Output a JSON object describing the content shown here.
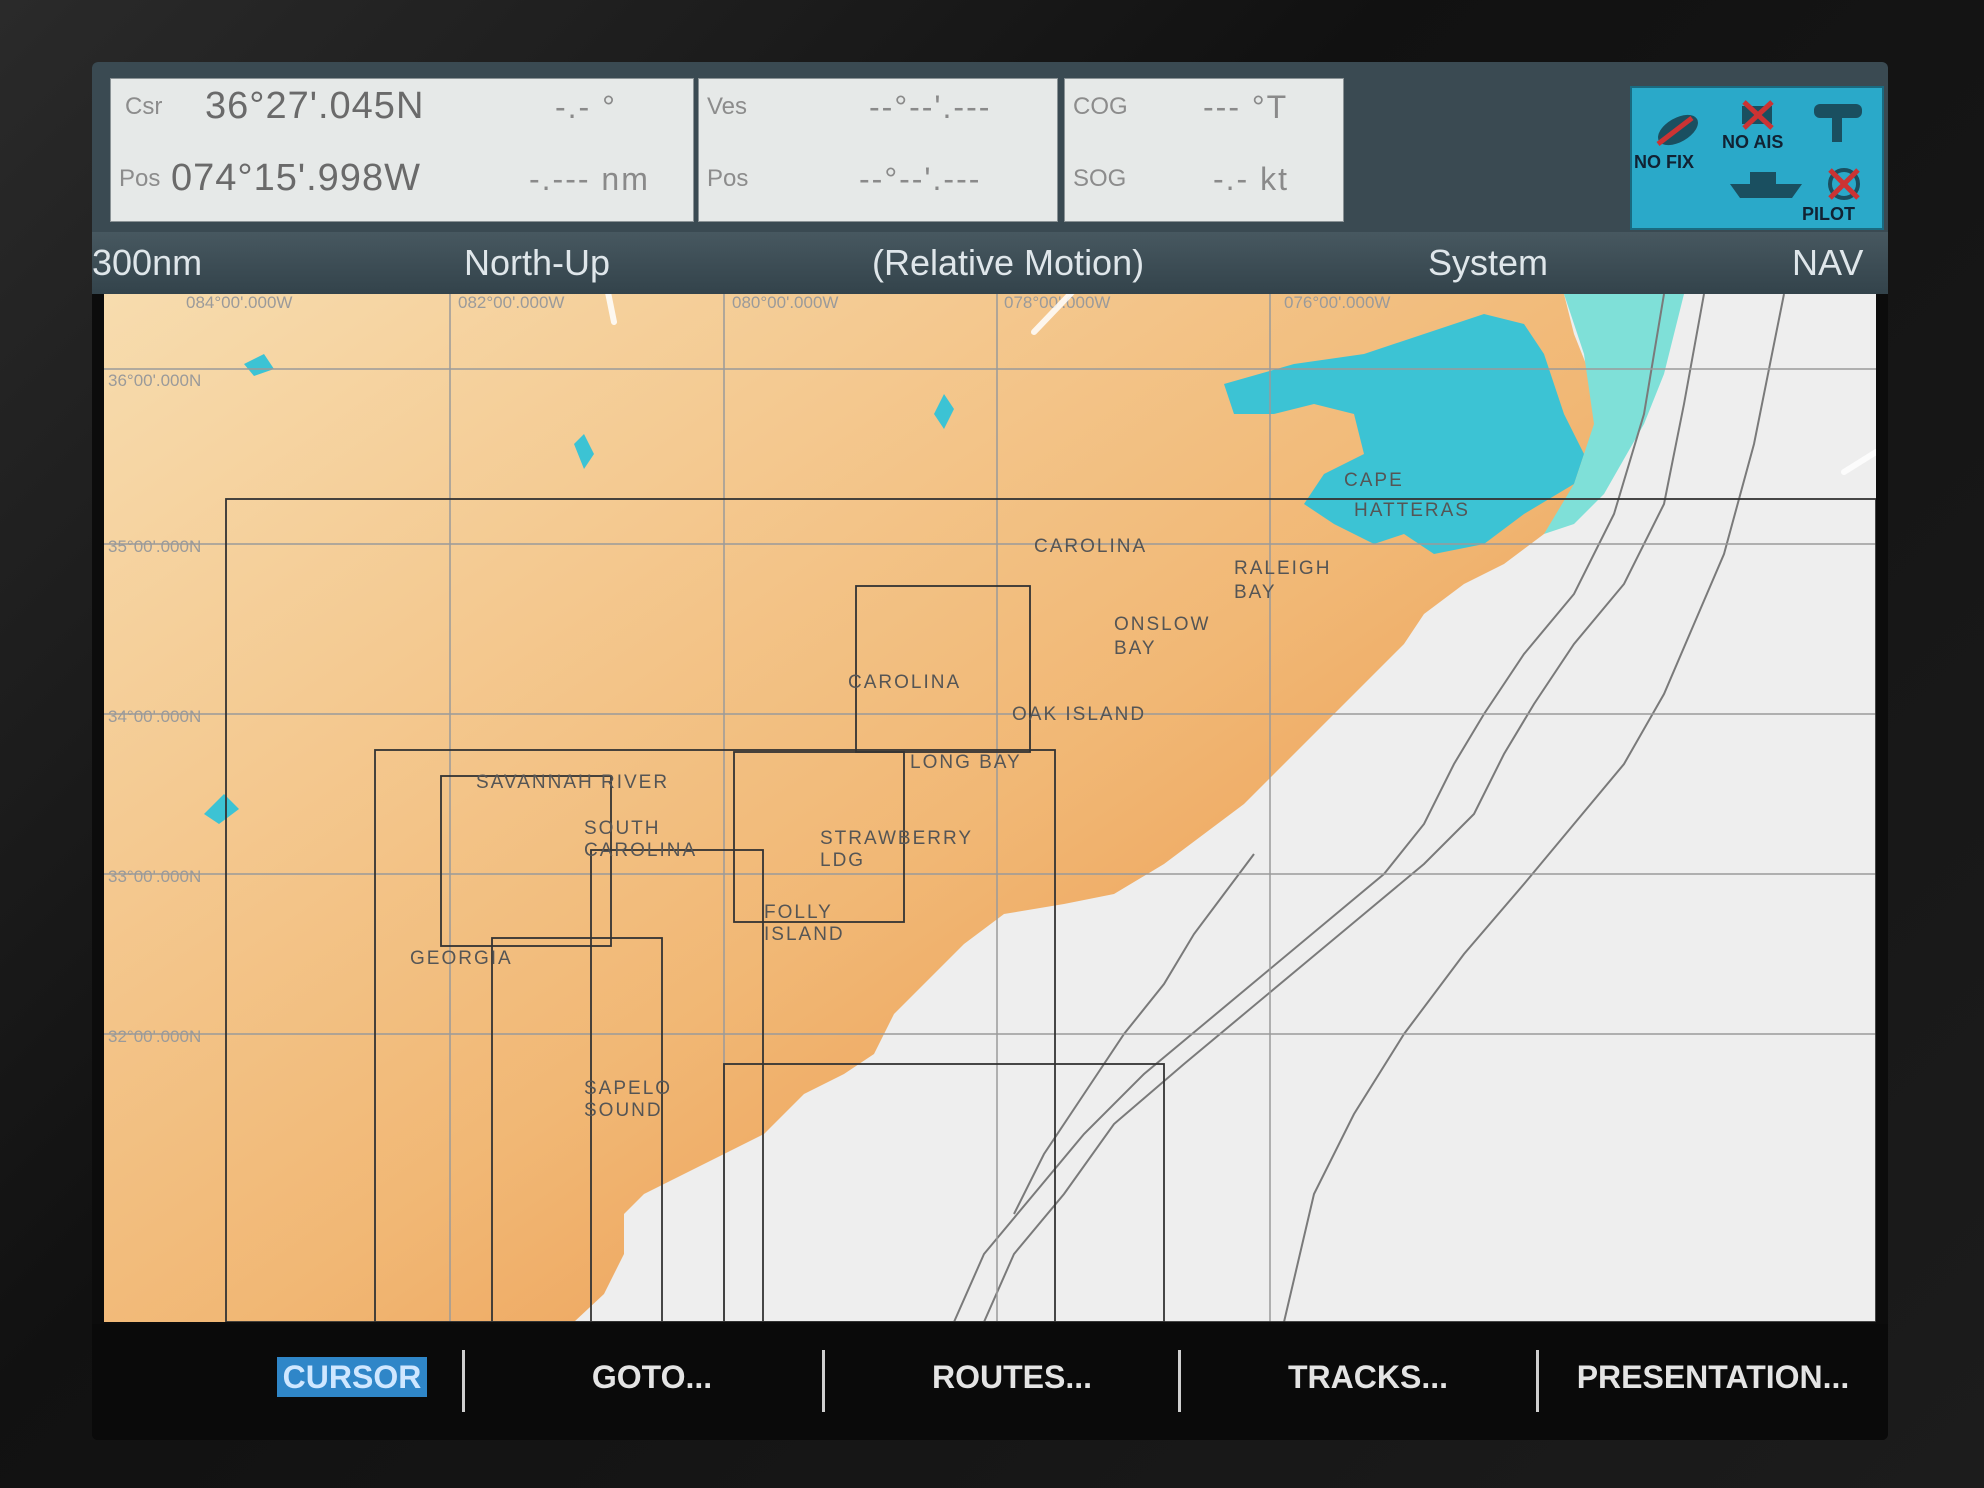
{
  "header": {
    "cursor_box": {
      "csr_label": "Csr",
      "pos_label": "Pos",
      "lat": "36°27'.045N",
      "lon": "074°15'.998W",
      "bearing": "-.- °",
      "range": "-.--- nm"
    },
    "vessel_box": {
      "ves_label": "Ves",
      "pos_label": "Pos",
      "lat": "--°--'.---",
      "lon": "--°--'.---"
    },
    "cog_box": {
      "cog_label": "COG",
      "sog_label": "SOG",
      "cog_value": "--- °T",
      "sog_value": "-.- kt"
    },
    "status": {
      "fix": "NO FIX",
      "ais": "NO AIS",
      "pilot": "PILOT"
    }
  },
  "title_bar": {
    "range": "300nm",
    "orientation": "North-Up",
    "motion": "(Relative Motion)",
    "mode": "System",
    "nav": "NAV"
  },
  "grid_labels": {
    "lon_084": "084°00'.000W",
    "lon_082": "082°00'.000W",
    "lon_080": "080°00'.000W",
    "lon_078": "078°00'.000W",
    "lon_076": "076°00'.000W",
    "lat_36": "36°00'.000N",
    "lat_35": "35°00'.000N",
    "lat_34": "34°00'.000N",
    "lat_33": "33°00'.000N",
    "lat_32": "32°00'.000N"
  },
  "place_labels": {
    "carolina_north": "CAROLINA",
    "cape": "CAPE",
    "hatteras": "HATTERAS",
    "raleigh": "RALEIGH",
    "raleigh_bay": "BAY",
    "onslow": "ONSLOW",
    "onslow_bay": "BAY",
    "carolina_chart": "CAROLINA",
    "oak_island": "OAK ISLAND",
    "long_bay": "LONG BAY",
    "savannah_river": "SAVANNAH RIVER",
    "south": "SOUTH",
    "carolina_south": "CAROLINA",
    "strawberry": "STRAWBERRY",
    "ldg": "LDG",
    "folly": "FOLLY",
    "island": "ISLAND",
    "georgia": "GEORGIA",
    "sapelo": "SAPELO",
    "sound": "SOUND"
  },
  "softkeys": [
    "CURSOR",
    "GOTO...",
    "ROUTES...",
    "TRACKS...",
    "PRESENTATION..."
  ],
  "colors": {
    "land_light": "#f6d9a8",
    "land_dark": "#e8893a",
    "sea": "#eeeeee",
    "shallow": "#3cc3d4",
    "shallow_light": "#7fe0d8",
    "chart_line": "#333333",
    "active_key": "#2f86c8"
  }
}
